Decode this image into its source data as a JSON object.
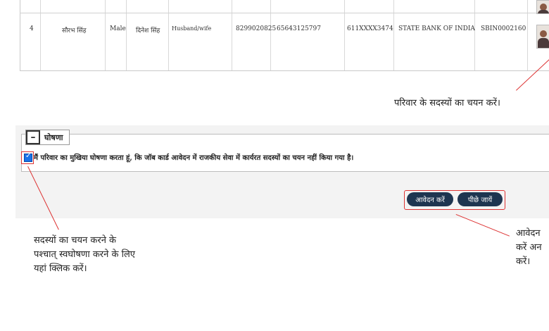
{
  "table": {
    "row": {
      "sr": "4",
      "name": "सौरभ सिंह",
      "gender": "Male",
      "relative_name": "दिनेश सिंह",
      "relation": "Husband/wife",
      "phone": "8299020825",
      "number2": "65643125797",
      "account": "611XXXX3474",
      "bank": "STATE BANK OF INDIA",
      "ifsc": "SBIN0002160"
    }
  },
  "annotations": {
    "select_members": "परिवार के सदस्यों का चयन करें।",
    "self_declare_line1": "सदस्यों का चयन करने के",
    "self_declare_line2": "पश्चात् स्वघोषणा करने के लिए",
    "self_declare_line3": "यहां क्लिक करें।",
    "apply_line1": "आवेदन",
    "apply_line2": "करें अन",
    "apply_line3": "करें।"
  },
  "declaration": {
    "legend": "घोषणा",
    "toggle_symbol": "–",
    "checked": true,
    "text": "मैं परिवार का मुखिया घोषणा करता हूं, कि जॉब कार्ड आवेदन में राजकीय सेवा में कार्यरत सदस्यों का चयन नहीं किया गया है।"
  },
  "buttons": {
    "apply": "आवेदन करें",
    "back": "पीछे जायें"
  },
  "colors": {
    "accent_red": "#dd3333",
    "button_bg": "#1e3550",
    "checkbox": "#1a73e8"
  }
}
